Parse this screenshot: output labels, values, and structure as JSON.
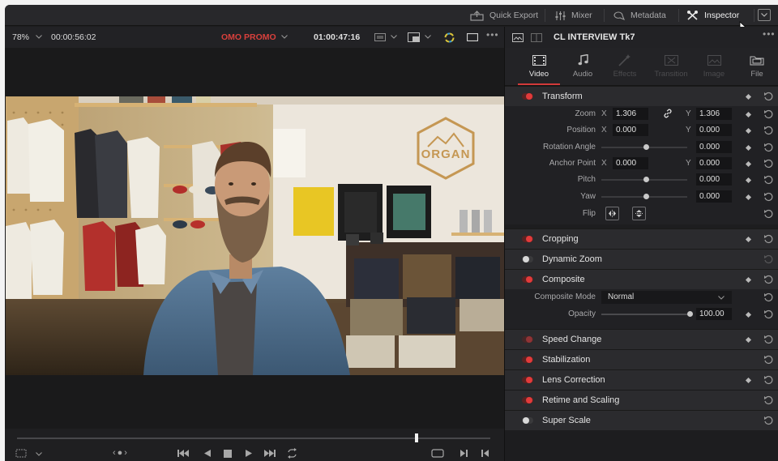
{
  "topbar": {
    "quick_export": "Quick Export",
    "mixer": "Mixer",
    "metadata": "Metadata",
    "inspector": "Inspector"
  },
  "viewer_header": {
    "zoom": "78%",
    "timecode_left": "00:00:56:02",
    "timeline_name": "OMO PROMO",
    "timecode_right": "01:00:47:16"
  },
  "inspector_header": {
    "clip_name": "CL INTERVIEW Tk7"
  },
  "tabs": [
    {
      "label": "Video",
      "icon": "video-icon",
      "state": "selected"
    },
    {
      "label": "Audio",
      "icon": "audio-icon",
      "state": "enabled"
    },
    {
      "label": "Effects",
      "icon": "effects-icon",
      "state": "disabled"
    },
    {
      "label": "Transition",
      "icon": "transition-icon",
      "state": "disabled"
    },
    {
      "label": "Image",
      "icon": "image-icon",
      "state": "disabled"
    },
    {
      "label": "File",
      "icon": "file-icon",
      "state": "enabled"
    }
  ],
  "transform": {
    "title": "Transform",
    "zoom_label": "Zoom",
    "zoom_x": "1.306",
    "zoom_y": "1.306",
    "position_label": "Position",
    "position_x": "0.000",
    "position_y": "0.000",
    "rotation_label": "Rotation Angle",
    "rotation_value": "0.000",
    "anchor_label": "Anchor Point",
    "anchor_x": "0.000",
    "anchor_y": "0.000",
    "pitch_label": "Pitch",
    "pitch_value": "0.000",
    "yaw_label": "Yaw",
    "yaw_value": "0.000",
    "flip_label": "Flip",
    "axis_x": "X",
    "axis_y": "Y"
  },
  "sections": {
    "cropping": "Cropping",
    "dynamic_zoom": "Dynamic Zoom",
    "composite": "Composite",
    "speed_change": "Speed Change",
    "stabilization": "Stabilization",
    "lens_correction": "Lens Correction",
    "retime_scaling": "Retime and Scaling",
    "super_scale": "Super Scale"
  },
  "composite": {
    "mode_label": "Composite Mode",
    "mode_value": "Normal",
    "opacity_label": "Opacity",
    "opacity_value": "100.00"
  },
  "scene": {
    "logo_text": "ORGAN"
  },
  "colors": {
    "accent_red": "#e23b3b",
    "timeline_name_red": "#d8403c",
    "panel_bg": "#212124"
  },
  "playback": {
    "scrub_position": 0.845
  }
}
